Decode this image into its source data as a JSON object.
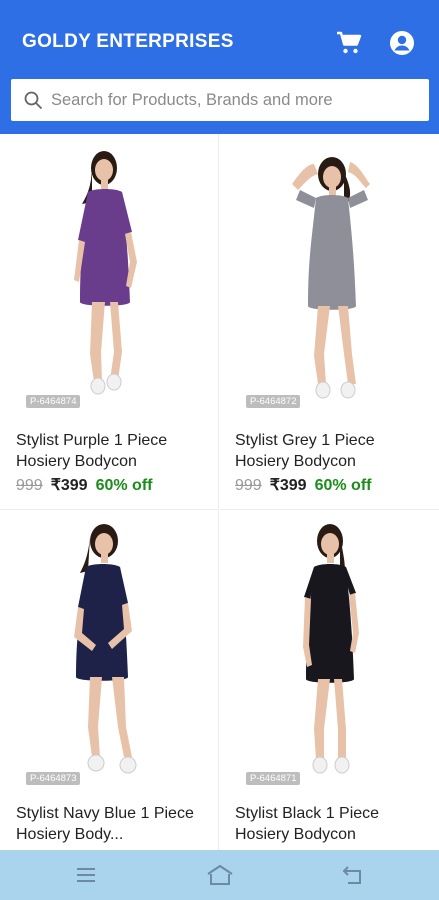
{
  "header": {
    "brand": "GOLDY ENTERPRISES",
    "cart_icon": "cart-icon",
    "account_icon": "account-icon",
    "color": "#2f6fe6"
  },
  "search": {
    "placeholder": "Search for Products, Brands and more",
    "icon": "search-icon"
  },
  "products": [
    {
      "sku": "P-6464874",
      "title": "Stylist Purple 1 Piece Hosiery Bodycon",
      "mrp": "999",
      "price": "₹399",
      "discount": "60% off",
      "dress_color": "#6a3d8c"
    },
    {
      "sku": "P-6464872",
      "title": "Stylist Grey 1 Piece Hosiery Bodycon",
      "mrp": "999",
      "price": "₹399",
      "discount": "60% off",
      "dress_color": "#8e8f99"
    },
    {
      "sku": "P-6464873",
      "title": "Stylist Navy Blue 1 Piece Hosiery Body...",
      "mrp": "",
      "price": "",
      "discount": "",
      "dress_color": "#1e2248"
    },
    {
      "sku": "P-6464871",
      "title": "Stylist Black 1 Piece Hosiery Bodycon",
      "mrp": "",
      "price": "",
      "discount": "",
      "dress_color": "#17171d"
    }
  ],
  "navbar": {
    "menu_icon": "menu-icon",
    "home_icon": "home-icon",
    "back_icon": "back-icon",
    "color": "#aad3ee"
  },
  "colors": {
    "discount": "#1a8d1a",
    "mrp": "#9a9a9a"
  }
}
